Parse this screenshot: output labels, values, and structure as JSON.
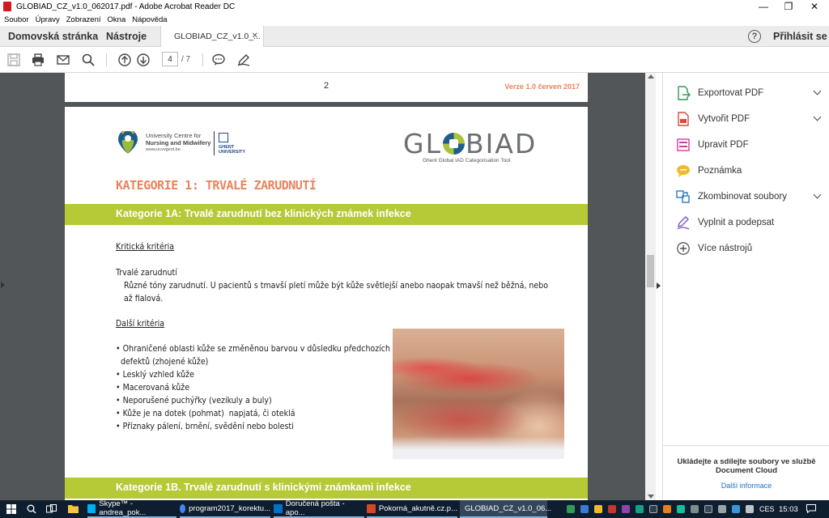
{
  "window": {
    "title": "GLOBIAD_CZ_v1.0_062017.pdf - Adobe Acrobat Reader DC",
    "controls": {
      "minimize": "—",
      "restore": "❐",
      "close": "✕"
    }
  },
  "menu": [
    "Soubor",
    "Úpravy",
    "Zobrazení",
    "Okna",
    "Nápověda"
  ],
  "tabs": {
    "home": "Domovská stránka",
    "tools": "Nástroje",
    "document": "GLOBIAD_CZ_v1.0_...",
    "close_glyph": "✕",
    "help_glyph": "?",
    "sign_in": "Přihlásit se"
  },
  "toolbar": {
    "icons": [
      "save-icon",
      "print-icon",
      "email-icon",
      "search-icon",
      "page-up-icon",
      "page-down-icon",
      "comment-icon",
      "pen-icon"
    ],
    "current_page": "4",
    "total_pages": "/ 7"
  },
  "document": {
    "prev_page_number": "2",
    "version_text": "Verze 1.0 červen 2017",
    "ucvv_logo_lines": [
      "University Centre for",
      "Nursing and Midwifery"
    ],
    "ucvv_url": "www.ucvvgent.be",
    "ghent_lines": [
      "GHENT",
      "UNIVERSITY"
    ],
    "globiad_pre": "GL",
    "globiad_post": "BIAD",
    "globiad_subtitle": "Ghent Global IAD Categorisation Tool",
    "category_heading": "KATEGORIE 1: TRVALÉ ZARUDNUTÍ",
    "section_1a": "Kategorie 1A: Trvalé zarudnutí bez klinických známek infekce",
    "critical_criteria_heading": "Kritická kritéria",
    "critical_term": "Trvalé zarudnutí",
    "critical_desc_line1": "Různé tóny zarudnutí. U pacientů s tmavší pletí může být kůže světlejší anebo naopak tmavší než běžná, nebo",
    "critical_desc_line2": "až fialová.",
    "other_criteria_heading": "Další kritéria",
    "other_criteria": [
      "• Ohraničené oblasti kůže se změněnou barvou v důsledku předchozích",
      "  defektů (zhojené kůže)",
      "• Lesklý vzhled kůže",
      "• Macerovaná kůže",
      "• Neporušené puchýřky (vezikuly a buly)",
      "• Kůže je na dotek (pohmat)  napjatá, či oteklá",
      "• Příznaky pálení, brnění, svědění nebo bolesti"
    ],
    "section_1b": "Kategorie 1B. Trvalé zarudnutí s klinickými známkami infekce"
  },
  "right_panel": {
    "tools": [
      {
        "label": "Exportovat PDF",
        "icon": "export-pdf-icon",
        "color": "#2d9a57",
        "has_menu": true
      },
      {
        "label": "Vytvořit PDF",
        "icon": "create-pdf-icon",
        "color": "#d94a3f",
        "has_menu": true
      },
      {
        "label": "Upravit PDF",
        "icon": "edit-pdf-icon",
        "color": "#cc3f9d",
        "has_menu": false
      },
      {
        "label": "Poznámka",
        "icon": "comment-icon",
        "color": "#f1b92e",
        "has_menu": false
      },
      {
        "label": "Zkombinovat soubory",
        "icon": "combine-files-icon",
        "color": "#2a79c4",
        "has_menu": true
      },
      {
        "label": "Vyplnit a podepsat",
        "icon": "fill-sign-icon",
        "color": "#7b56c2",
        "has_menu": false
      },
      {
        "label": "Více nástrojů",
        "icon": "more-tools-icon",
        "color": "#555555",
        "has_menu": false
      }
    ],
    "cloud_text_line1": "Ukládejte a sdílejte soubory ve službě",
    "cloud_text_line2": "Document Cloud",
    "cloud_link": "Další informace"
  },
  "taskbar": {
    "items": [
      {
        "label": "Skype™ - andrea_pok...",
        "color": "#00aff0",
        "state": "open"
      },
      {
        "label": "program2017_korektu...",
        "color": "#4285f4",
        "state": "open"
      },
      {
        "label": "Doručená pošta - apo...",
        "color": "#0072c6",
        "state": "open"
      },
      {
        "label": "Pokorná_akutně.cz.p...",
        "color": "#d24726",
        "state": "open"
      },
      {
        "label": "GLOBIAD_CZ_v1.0_06...",
        "color": "#d7191b",
        "state": "active"
      }
    ],
    "language": "CES",
    "time": "15:03"
  }
}
